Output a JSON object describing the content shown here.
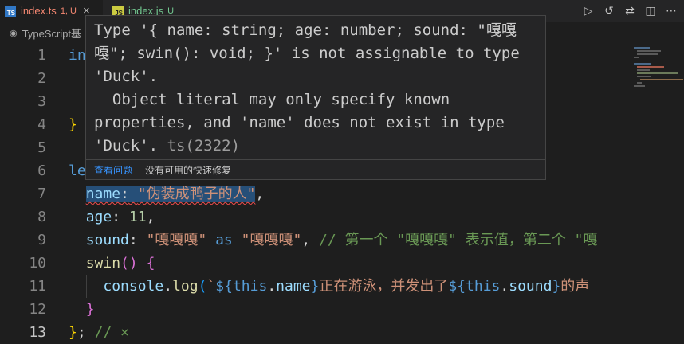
{
  "tabs": [
    {
      "icon": "TS",
      "name": "index.ts",
      "badge": "1, U",
      "close": "×",
      "active": true,
      "color": "#f48771"
    },
    {
      "icon": "JS",
      "name": "index.js",
      "badge": "U",
      "active": false,
      "color": "#73c991"
    }
  ],
  "toolbar": {
    "run": "▷",
    "history": "↺",
    "compare": "⇄",
    "split": "◫",
    "more": "⋯"
  },
  "breadcrumb": {
    "icon": "◉",
    "text": "TypeScript基"
  },
  "line_numbers": [
    "1",
    "2",
    "3",
    "4",
    "5",
    "6",
    "7",
    "8",
    "9",
    "10",
    "11",
    "12",
    "13"
  ],
  "current_line": "13",
  "code": {
    "l1": "in",
    "l4": "}",
    "l6": "le",
    "l7_key": "name",
    "l7_colon": ":",
    "l7_val": "\"伪装成鸭子的人\"",
    "l7_comma": ",",
    "l8_key": "age",
    "l8_colon": ": ",
    "l8_val": "11",
    "l8_comma": ",",
    "l9_key": "sound",
    "l9_colon": ": ",
    "l9_val": "\"嘎嘎嘎\"",
    "l9_as": " as ",
    "l9_val2": "\"嘎嘎嘎\"",
    "l9_comma": ", ",
    "l9_comment": "// 第一个 \"嘎嘎嘎\" 表示值，第二个 \"嘎",
    "l10_fn": "swin",
    "l10_paren": "()",
    "l10_space": " ",
    "l10_brace": "{",
    "l11_console": "console",
    "l11_dot": ".",
    "l11_log": "log",
    "l11_paren": "(",
    "l11_tick": "`",
    "l11_d1": "${",
    "l11_this1": "this",
    "l11_dot1": ".",
    "l11_name": "name",
    "l11_c1": "}",
    "l11_text1": "正在游泳，并发出了",
    "l11_d2": "${",
    "l11_this2": "this",
    "l11_dot2": ".",
    "l11_sound": "sound",
    "l11_c2": "}",
    "l11_text2": "的声",
    "l12": "}",
    "l13_brace": "}",
    "l13_semi": ";",
    "l13_comment": " // ×"
  },
  "hover": {
    "message": "Type '{ name: string; age: number; sound: \"嘎嘎\n嘎\"; swin(): void; }' is not assignable to type\n'Duck'.\n  Object literal may only specify known\nproperties, and 'name' does not exist in type\n'Duck'. ",
    "code": "ts(2322)",
    "view_problem": "查看问题",
    "no_fix": "没有可用的快速修复"
  }
}
